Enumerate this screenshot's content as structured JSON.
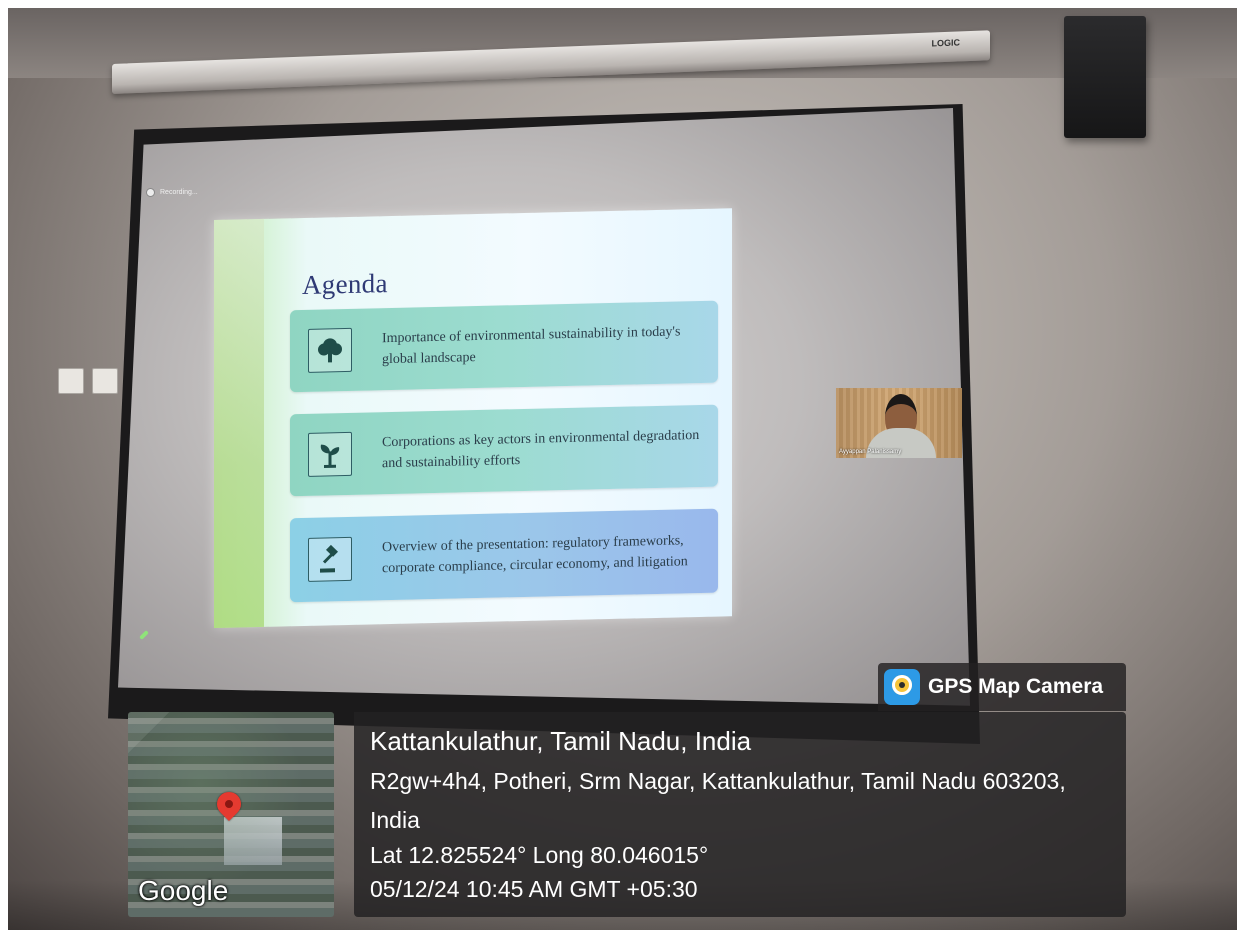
{
  "projector": {
    "brand": "LOGIC"
  },
  "meeting": {
    "recording_label": "Recording...",
    "participant_name": "Ayyappan Palanissamy"
  },
  "slide": {
    "title": "Agenda",
    "items": [
      {
        "icon": "tree-icon",
        "text": "Importance of environmental sustainability in today's global landscape"
      },
      {
        "icon": "sprout-icon",
        "text": "Corporations as key actors in environmental degradation and sustainability efforts"
      },
      {
        "icon": "gavel-icon",
        "text": "Overview of the presentation: regulatory frameworks, corporate compliance, circular economy, and litigation"
      }
    ]
  },
  "gps_overlay": {
    "app_name": "GPS Map Camera",
    "map_brand": "Google",
    "location_title": "Kattankulathur, Tamil Nadu, India",
    "address": "R2gw+4h4, Potheri, Srm Nagar, Kattankulathur, Tamil Nadu 603203, India",
    "lat_long": "Lat 12.825524° Long 80.046015°",
    "datetime": "05/12/24 10:45 AM GMT +05:30"
  },
  "colors": {
    "overlay_bg": "#232122",
    "slide_title": "#2f3a75",
    "card_green": "#8fd5c2",
    "card_blue": "#8cd0e6",
    "pin_red": "#e53a30"
  }
}
